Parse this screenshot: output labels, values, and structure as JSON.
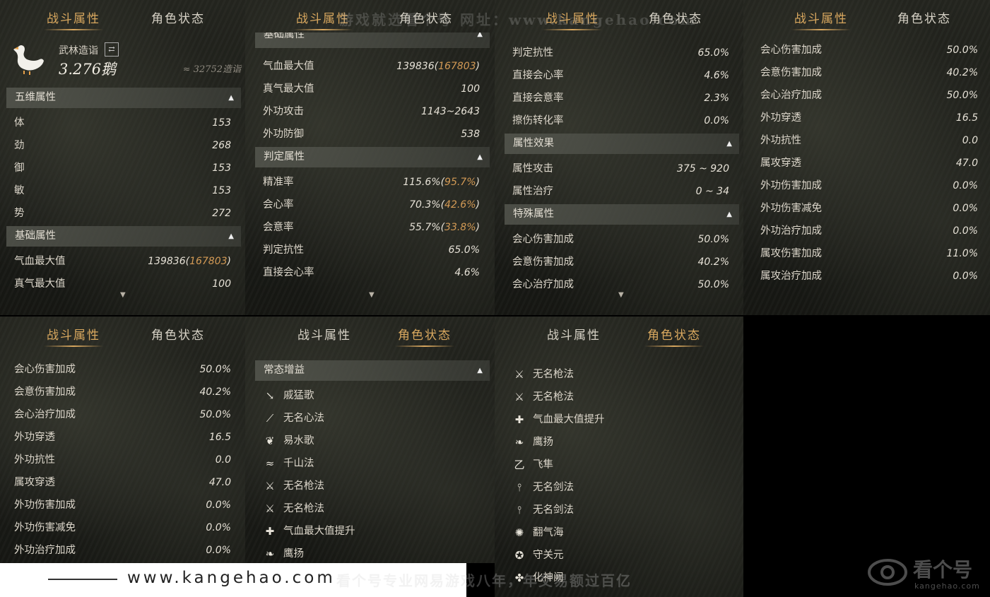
{
  "watermarks": {
    "top": "游戏就选看个号 网址：www.kangehao.com",
    "bottom_url": "www.kangehao.com",
    "bottom_text": "看个号专业网易游戏八年，年交易额过百亿",
    "logo_text": "看个号",
    "logo_sub": "kangehao.com"
  },
  "panel1": {
    "tabs": [
      "战斗属性",
      "角色状态"
    ],
    "active_tab": 0,
    "profile": {
      "title": "武林造诣",
      "value": "3.276鹅",
      "approx": "≈ 32752造诣"
    },
    "sections": [
      {
        "header": "五维属性",
        "rows": [
          {
            "label": "体",
            "value": "153"
          },
          {
            "label": "劲",
            "value": "268"
          },
          {
            "label": "御",
            "value": "153"
          },
          {
            "label": "敏",
            "value": "153"
          },
          {
            "label": "势",
            "value": "272"
          }
        ]
      },
      {
        "header": "基础属性",
        "rows": [
          {
            "label": "气血最大值",
            "value": "139836",
            "extra": "167803"
          },
          {
            "label": "真气最大值",
            "value": "100"
          }
        ]
      }
    ]
  },
  "panel2": {
    "tabs": [
      "战斗属性",
      "角色状态"
    ],
    "active_tab": 0,
    "top_header_partial": "基础属性",
    "rows_a": [
      {
        "label": "气血最大值",
        "value": "139836",
        "extra": "167803"
      },
      {
        "label": "真气最大值",
        "value": "100"
      },
      {
        "label": "外功攻击",
        "value": "1143~2643"
      },
      {
        "label": "外功防御",
        "value": "538"
      }
    ],
    "header_b": "判定属性",
    "rows_b": [
      {
        "label": "精准率",
        "value": "115.6%",
        "extra": "95.7%"
      },
      {
        "label": "会心率",
        "value": "70.3%",
        "extra": "42.6%"
      },
      {
        "label": "会意率",
        "value": "55.7%",
        "extra": "33.8%"
      },
      {
        "label": "判定抗性",
        "value": "65.0%"
      },
      {
        "label": "直接会心率",
        "value": "4.6%"
      }
    ]
  },
  "panel3": {
    "tabs": [
      "战斗属性",
      "角色状态"
    ],
    "active_tab": 0,
    "rows_a": [
      {
        "label": "判定抗性",
        "value": "65.0%"
      },
      {
        "label": "直接会心率",
        "value": "4.6%"
      },
      {
        "label": "直接会意率",
        "value": "2.3%"
      },
      {
        "label": "擦伤转化率",
        "value": "0.0%"
      }
    ],
    "header_b": "属性效果",
    "rows_b": [
      {
        "label": "属性攻击",
        "value": "375 ~ 920"
      },
      {
        "label": "属性治疗",
        "value": "0 ~ 34"
      }
    ],
    "header_c": "特殊属性",
    "rows_c": [
      {
        "label": "会心伤害加成",
        "value": "50.0%"
      },
      {
        "label": "会意伤害加成",
        "value": "40.2%"
      },
      {
        "label": "会心治疗加成",
        "value": "50.0%"
      }
    ]
  },
  "panel4": {
    "tabs": [
      "战斗属性",
      "角色状态"
    ],
    "active_tab": 0,
    "rows": [
      {
        "label": "会心伤害加成",
        "value": "50.0%"
      },
      {
        "label": "会意伤害加成",
        "value": "40.2%"
      },
      {
        "label": "会心治疗加成",
        "value": "50.0%"
      },
      {
        "label": "外功穿透",
        "value": "16.5"
      },
      {
        "label": "外功抗性",
        "value": "0.0"
      },
      {
        "label": "属攻穿透",
        "value": "47.0"
      },
      {
        "label": "外功伤害加成",
        "value": "0.0%"
      },
      {
        "label": "外功伤害减免",
        "value": "0.0%"
      },
      {
        "label": "外功治疗加成",
        "value": "0.0%"
      },
      {
        "label": "属攻伤害加成",
        "value": "11.0%"
      },
      {
        "label": "属攻治疗加成",
        "value": "0.0%"
      }
    ]
  },
  "panel5": {
    "tabs": [
      "战斗属性",
      "角色状态"
    ],
    "active_tab": 0,
    "rows": [
      {
        "label": "会心伤害加成",
        "value": "50.0%"
      },
      {
        "label": "会意伤害加成",
        "value": "40.2%"
      },
      {
        "label": "会心治疗加成",
        "value": "50.0%"
      },
      {
        "label": "外功穿透",
        "value": "16.5"
      },
      {
        "label": "外功抗性",
        "value": "0.0"
      },
      {
        "label": "属攻穿透",
        "value": "47.0"
      },
      {
        "label": "外功伤害加成",
        "value": "0.0%"
      },
      {
        "label": "外功伤害减免",
        "value": "0.0%"
      },
      {
        "label": "外功治疗加成",
        "value": "0.0%"
      }
    ]
  },
  "panel6": {
    "tabs": [
      "战斗属性",
      "角色状态"
    ],
    "active_tab": 1,
    "header": "常态增益",
    "buffs": [
      {
        "icon": "bird-icon",
        "glyph": "↘",
        "name": "戚猛歌"
      },
      {
        "icon": "dancer-icon",
        "glyph": "⟋",
        "name": "无名心法"
      },
      {
        "icon": "beast-icon",
        "glyph": "❦",
        "name": "易水歌"
      },
      {
        "icon": "wind-icon",
        "glyph": "≈",
        "name": "千山法"
      },
      {
        "icon": "spear-icon",
        "glyph": "⚔",
        "name": "无名枪法"
      },
      {
        "icon": "spear-icon",
        "glyph": "⚔",
        "name": "无名枪法"
      },
      {
        "icon": "heart-up-icon",
        "glyph": "✚",
        "name": "气血最大值提升"
      },
      {
        "icon": "eagle-icon",
        "glyph": "❧",
        "name": "鹰扬"
      }
    ]
  },
  "panel7": {
    "tabs": [
      "战斗属性",
      "角色状态"
    ],
    "active_tab": 1,
    "buffs": [
      {
        "icon": "spear-icon",
        "glyph": "⚔",
        "name": "无名枪法"
      },
      {
        "icon": "spear-icon",
        "glyph": "⚔",
        "name": "无名枪法"
      },
      {
        "icon": "heart-up-icon",
        "glyph": "✚",
        "name": "气血最大值提升"
      },
      {
        "icon": "eagle-icon",
        "glyph": "❧",
        "name": "鹰扬"
      },
      {
        "icon": "swallow-icon",
        "glyph": "乙",
        "name": "飞隼"
      },
      {
        "icon": "sword-icon",
        "glyph": "⫯",
        "name": "无名剑法"
      },
      {
        "icon": "sword-icon",
        "glyph": "⫯",
        "name": "无名剑法"
      },
      {
        "icon": "wave-icon",
        "glyph": "✺",
        "name": "翻气海"
      },
      {
        "icon": "guard-icon",
        "glyph": "✪",
        "name": "守关元"
      },
      {
        "icon": "transform-icon",
        "glyph": "✤",
        "name": "化神阙"
      }
    ]
  }
}
